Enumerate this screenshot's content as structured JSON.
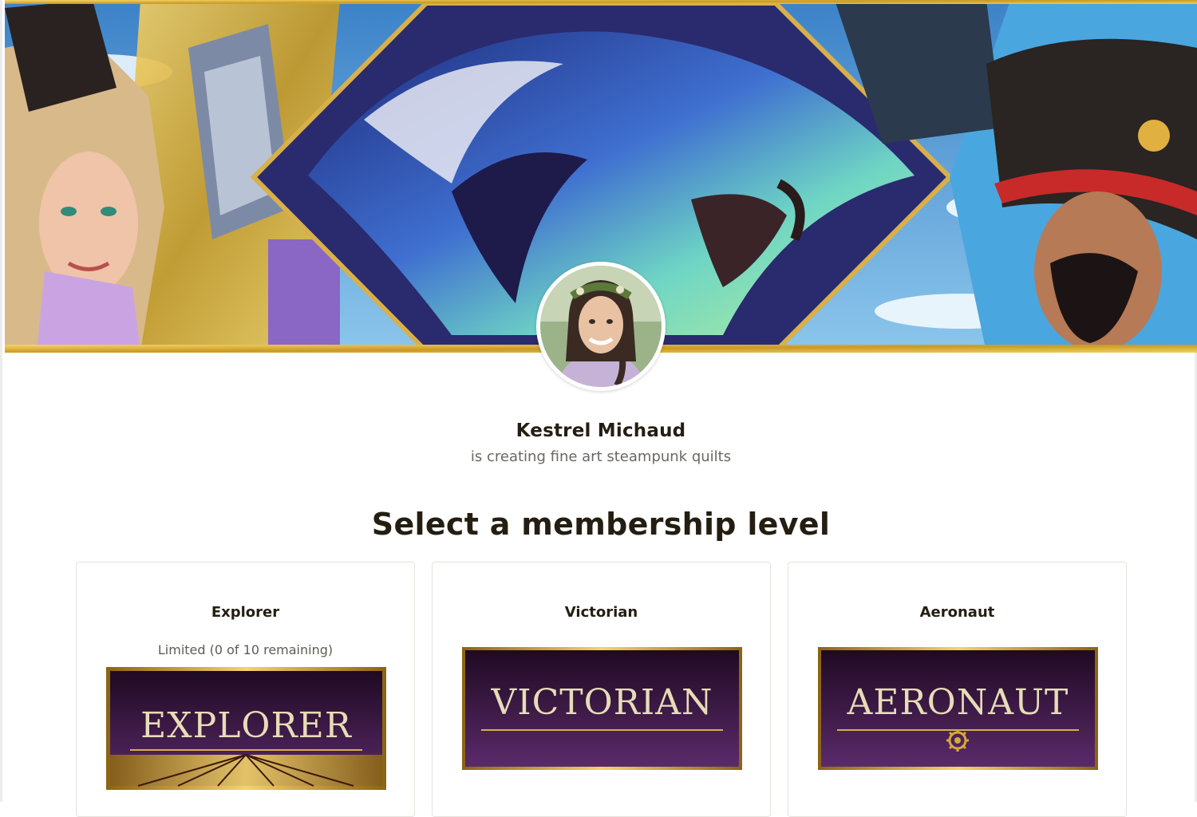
{
  "creator": {
    "name": "Kestrel Michaud",
    "tagline": "is creating fine art steampunk quilts"
  },
  "page": {
    "heading": "Select a membership level"
  },
  "tiers": [
    {
      "title": "Explorer",
      "limit_text": "Limited (0 of 10 remaining)",
      "art_text": "EXPLORER",
      "art_icon": "sunburst-icon"
    },
    {
      "title": "Victorian",
      "art_text": "VICTORIAN"
    },
    {
      "title": "Aeronaut",
      "art_text": "AERONAUT",
      "art_icon": "gear-icon"
    }
  ],
  "colors": {
    "tier_art_bg": "#3a1744",
    "tier_art_border": "#c9a23a",
    "heading_text": "#241e12",
    "muted_text": "#6b6862"
  }
}
